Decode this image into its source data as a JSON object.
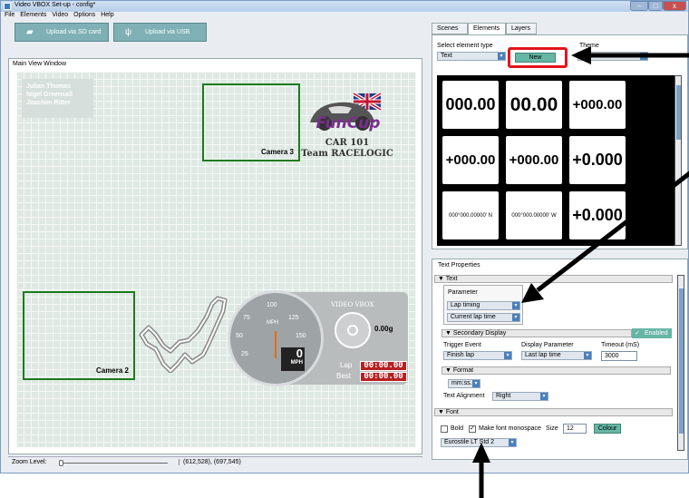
{
  "window": {
    "title": "Video VBOX Set-up - config*",
    "minimize": "–",
    "maximize": "□",
    "close": "x"
  },
  "menu": [
    "File",
    "Elements",
    "Video",
    "Options",
    "Help"
  ],
  "toolbar": {
    "upload_sd": "Upload via SD card",
    "upload_usb": "Upload via USB"
  },
  "main_view": {
    "label": "Main View Window",
    "names": [
      "Julian Thomas",
      "Nigel Greensall",
      "Joachim Ritter"
    ],
    "camera3": "Camera 3",
    "camera2": "Camera 2",
    "logo_text": "FunCup",
    "car_line1": "CAR 101",
    "car_line2": "Team RACELOGIC",
    "brand": "VIDEO VBOX",
    "gforce": "0.00g",
    "speed_value": "0",
    "speed_unit": "MPH",
    "gauge_unit": "MPH",
    "gauge_ticks": [
      "25",
      "50",
      "75",
      "100",
      "125",
      "150"
    ],
    "lap_label": "Lap",
    "lap_time": "00:00.00",
    "best_label": "Best",
    "best_time": "00:00.00"
  },
  "status": {
    "zoom_label": "Zoom Level:",
    "coords": "(612,528), (697,545)"
  },
  "tabs": [
    "Scenes",
    "Elements",
    "Layers"
  ],
  "elements_panel": {
    "select_label": "Select element type",
    "select_value": "Text",
    "new_button": "New",
    "theme_label": "Theme",
    "cells": [
      "000.00",
      "00.00",
      "+000.00",
      "+000.00",
      "+000.00",
      "+0.000",
      "000°000.00000' N",
      "000°000.00000' W",
      "+0.000"
    ]
  },
  "text_properties": {
    "title": "Text Properties",
    "text_section": "Text",
    "parameter_label": "Parameter",
    "parameter_value": "Lap timing",
    "subparameter_value": "Current lap time",
    "secondary_section": "Secondary Display",
    "enabled": "Enabled",
    "trigger_label": "Trigger Event",
    "trigger_value": "Finish lap",
    "display_param_label": "Display Parameter",
    "display_param_value": "Last lap time",
    "timeout_label": "Timeout (mS)",
    "timeout_value": "3000",
    "format_section": "Format",
    "format_value": "mm:ss.ss",
    "alignment_label": "Text Alignment",
    "alignment_value": "Right",
    "font_section": "Font",
    "bold_label": "Bold",
    "monospace_label": "Make font monospace",
    "size_label": "Size",
    "size_value": "12",
    "colour_button": "Colour",
    "font_value": "Eurostile LT Std 2"
  },
  "colors": {
    "accent": "#66b6a4",
    "highlight": "#e3141c",
    "camera_border": "#1e7a1e"
  }
}
